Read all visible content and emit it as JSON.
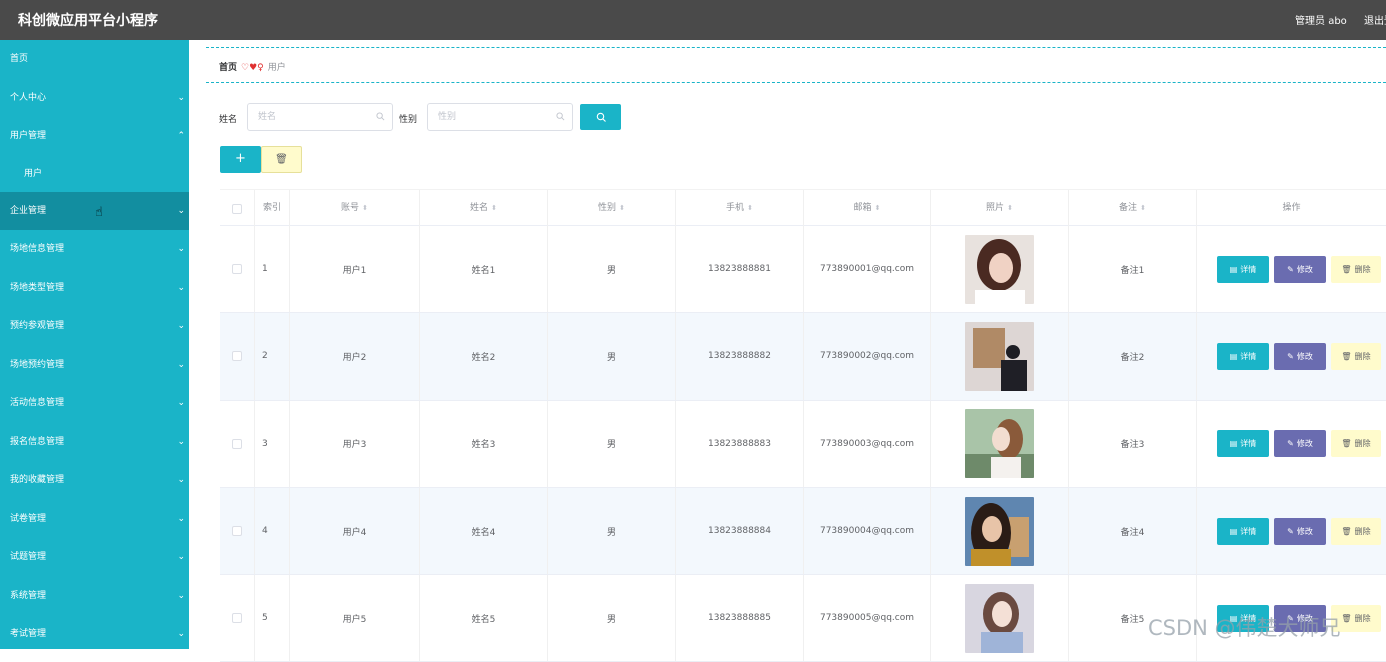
{
  "header": {
    "title": "科创微应用平台小程序",
    "user": "管理员 abo",
    "logout": "退出登"
  },
  "sidebar": {
    "items": [
      {
        "label": "首页",
        "chevron": ""
      },
      {
        "label": "个人中心",
        "chevron": "⌄"
      },
      {
        "label": "用户管理",
        "chevron": "⌃"
      },
      {
        "label": "用户",
        "chevron": ""
      },
      {
        "label": "企业管理",
        "chevron": "⌄"
      },
      {
        "label": "场地信息管理",
        "chevron": "⌄"
      },
      {
        "label": "场地类型管理",
        "chevron": "⌄"
      },
      {
        "label": "预约参观管理",
        "chevron": "⌄"
      },
      {
        "label": "场地预约管理",
        "chevron": "⌄"
      },
      {
        "label": "活动信息管理",
        "chevron": "⌄"
      },
      {
        "label": "报名信息管理",
        "chevron": "⌄"
      },
      {
        "label": "我的收藏管理",
        "chevron": "⌄"
      },
      {
        "label": "试卷管理",
        "chevron": "⌄"
      },
      {
        "label": "试题管理",
        "chevron": "⌄"
      },
      {
        "label": "系统管理",
        "chevron": "⌄"
      },
      {
        "label": "考试管理",
        "chevron": "⌄"
      }
    ]
  },
  "breadcrumb": {
    "home": "首页",
    "separator": "♡♥♀",
    "current": "用户"
  },
  "search": {
    "name_label": "姓名",
    "name_placeholder": "姓名",
    "gender_label": "性别",
    "gender_placeholder": "性别"
  },
  "toolbar": {
    "add_icon": "+",
    "delete_icon": "🗑"
  },
  "table": {
    "headers": [
      "索引",
      "账号",
      "姓名",
      "性别",
      "手机",
      "邮箱",
      "照片",
      "备注",
      "操作"
    ],
    "sort_glyph": "⬍",
    "rows": [
      {
        "index": "1",
        "account": "用户1",
        "name": "姓名1",
        "gender": "男",
        "phone": "13823888881",
        "email": "773890001@qq.com",
        "note": "备注1"
      },
      {
        "index": "2",
        "account": "用户2",
        "name": "姓名2",
        "gender": "男",
        "phone": "13823888882",
        "email": "773890002@qq.com",
        "note": "备注2"
      },
      {
        "index": "3",
        "account": "用户3",
        "name": "姓名3",
        "gender": "男",
        "phone": "13823888883",
        "email": "773890003@qq.com",
        "note": "备注3"
      },
      {
        "index": "4",
        "account": "用户4",
        "name": "姓名4",
        "gender": "男",
        "phone": "13823888884",
        "email": "773890004@qq.com",
        "note": "备注4"
      },
      {
        "index": "5",
        "account": "用户5",
        "name": "姓名5",
        "gender": "男",
        "phone": "13823888885",
        "email": "773890005@qq.com",
        "note": "备注5"
      }
    ],
    "actions": {
      "detail": "详情",
      "edit": "修改",
      "delete": "删除"
    }
  },
  "watermark": "CSDN @伟楚大师兄",
  "colors": {
    "accent": "#1ab4c8",
    "edit": "#6a6cb0",
    "delete_bg": "#fffbcc",
    "topbar": "#4a4a4a"
  }
}
